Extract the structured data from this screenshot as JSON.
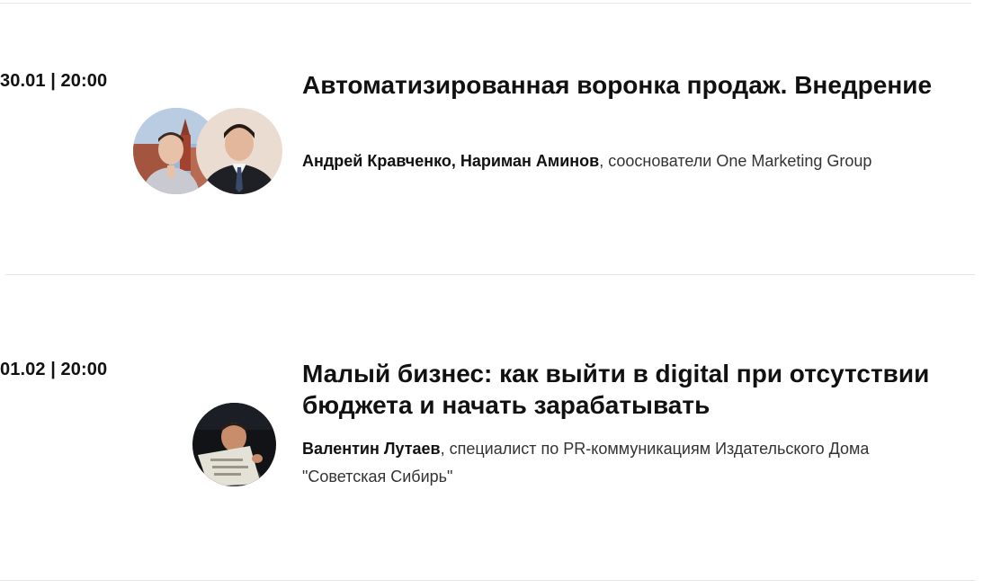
{
  "events": [
    {
      "date": "30.01 | 20:00",
      "title": "Автоматизированная воронка продаж. Внедрение",
      "speaker_names": "Андрей Кравченко, Нариман Аминов",
      "speaker_role": ", сооснователи One Marketing Group",
      "avatars": [
        "photo-portrait-1",
        "photo-portrait-2"
      ]
    },
    {
      "date": "01.02 | 20:00",
      "title": "Малый бизнес: как выйти в digital при отсутствии бюджета и начать зарабатывать",
      "speaker_names": "Валентин Лутаев",
      "speaker_role": ", специалист по PR-коммуникациям Издательского Дома \"Советская Сибирь\"",
      "avatars": [
        "photo-portrait-3"
      ]
    }
  ]
}
